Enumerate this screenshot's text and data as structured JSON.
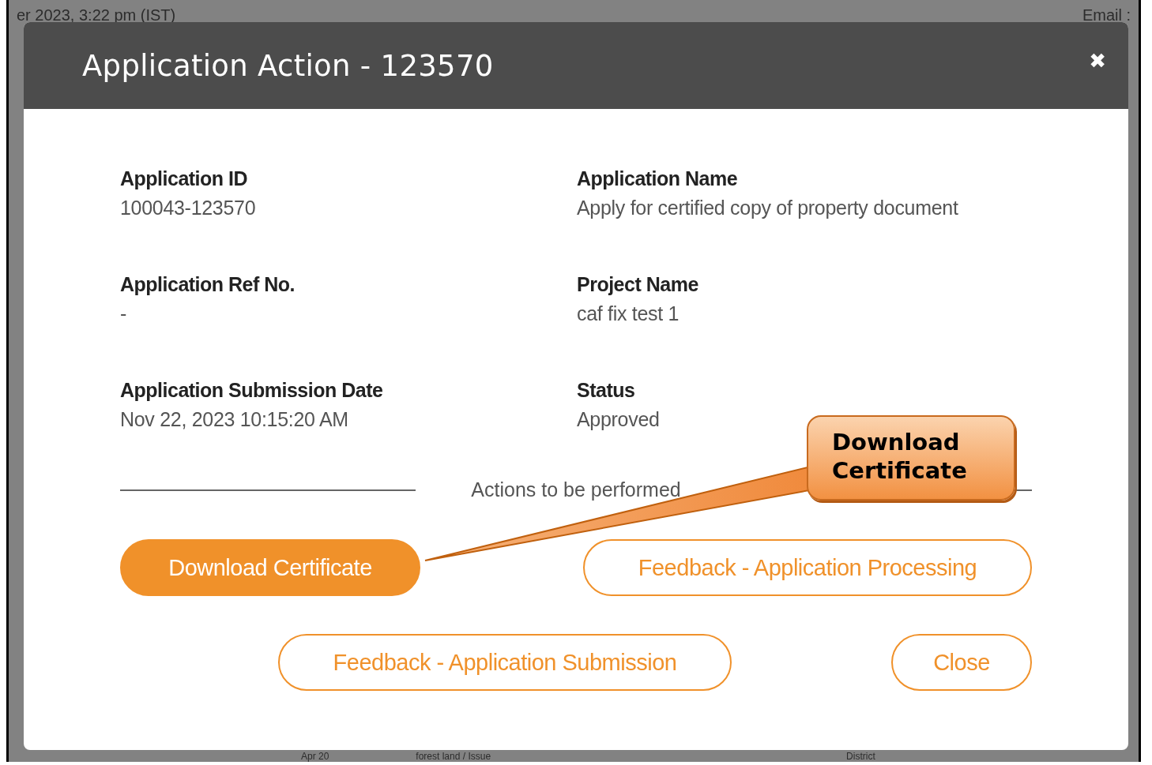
{
  "background": {
    "top_texts": [
      "er 2023, 3:22 pm (IST)",
      "Email :"
    ],
    "bottom_texts": [
      "Apr 20",
      "forest land / Issue",
      "District"
    ]
  },
  "modal": {
    "title": "Application Action - 123570",
    "close_icon": "✖",
    "fields": [
      {
        "label": "Application ID",
        "value": "100043-123570"
      },
      {
        "label": "Application Name",
        "value": "Apply for certified copy of property document"
      },
      {
        "label": "Application Ref No.",
        "value": "-"
      },
      {
        "label": "Project Name",
        "value": "caf fix test 1"
      },
      {
        "label": "Application Submission Date",
        "value": "Nov 22, 2023 10:15:20 AM"
      },
      {
        "label": "Status",
        "value": "Approved"
      }
    ],
    "divider_text": "Actions to be performed",
    "buttons": [
      {
        "label": "Download Certificate",
        "kind": "filled"
      },
      {
        "label": "Feedback - Application Processing",
        "kind": "outline"
      },
      {
        "label": "Feedback - Application Submission",
        "kind": "outline"
      },
      {
        "label": "Close",
        "kind": "outline"
      }
    ]
  },
  "callout": {
    "text": "Download Certificate"
  }
}
